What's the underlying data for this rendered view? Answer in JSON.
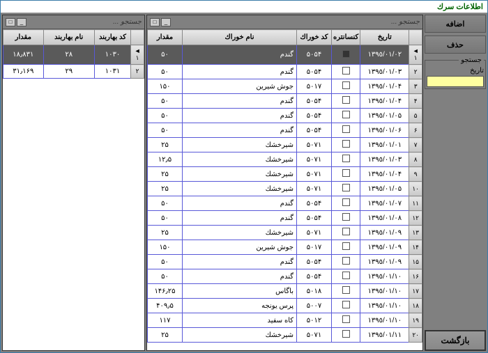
{
  "window": {
    "title": "اطلاعات سرك"
  },
  "sidebar": {
    "add": "اضافه",
    "delete": "حذف",
    "search_group": "جستجو",
    "date_label": "تاریخ",
    "back": "بازگشت"
  },
  "panel": {
    "search_hint": "جستجو ..."
  },
  "main_grid": {
    "headers": {
      "date": "تاریخ",
      "concentrate": "کنسانتره",
      "feed_code": "كد خوراك",
      "feed_name": "نام خوراك",
      "qty": "مقدار"
    },
    "rows": [
      {
        "n": "١",
        "date": "١٣٩٥/٠١/٠٢",
        "chk": "filled",
        "code": "۵٠۵۴",
        "name": "گندم",
        "qty": "۵٠",
        "sel": true
      },
      {
        "n": "٢",
        "date": "١٣٩٥/٠١/٠٣",
        "chk": "",
        "code": "۵٠۵۴",
        "name": "گندم",
        "qty": "۵٠"
      },
      {
        "n": "٣",
        "date": "١٣٩٥/٠١/٠۴",
        "chk": "",
        "code": "۵٠١٧",
        "name": "جوش شیرین",
        "qty": "١۵٠"
      },
      {
        "n": "۴",
        "date": "١٣٩٥/٠١/٠۴",
        "chk": "",
        "code": "۵٠۵۴",
        "name": "گندم",
        "qty": "۵٠"
      },
      {
        "n": "۵",
        "date": "١٣٩٥/٠١/٠۵",
        "chk": "",
        "code": "۵٠۵۴",
        "name": "گندم",
        "qty": "۵٠"
      },
      {
        "n": "۶",
        "date": "١٣٩٥/٠١/٠۶",
        "chk": "",
        "code": "۵٠۵۴",
        "name": "گندم",
        "qty": "۵٠"
      },
      {
        "n": "٧",
        "date": "١٣٩٥/٠١/٠١",
        "chk": "",
        "code": "۵٠٧١",
        "name": "شیرخشك",
        "qty": "٢۵"
      },
      {
        "n": "٨",
        "date": "١٣٩٥/٠١/٠٣",
        "chk": "",
        "code": "۵٠٧١",
        "name": "شيرخشك",
        "qty": "١٢٫۵"
      },
      {
        "n": "٩",
        "date": "١٣٩٥/٠١/٠۴",
        "chk": "",
        "code": "۵٠٧١",
        "name": "شيرخشك",
        "qty": "٢۵"
      },
      {
        "n": "١٠",
        "date": "١٣٩٥/٠١/٠۵",
        "chk": "",
        "code": "۵٠٧١",
        "name": "شيرخشك",
        "qty": "٢۵"
      },
      {
        "n": "١١",
        "date": "١٣٩٥/٠١/٠٧",
        "chk": "",
        "code": "۵٠۵۴",
        "name": "گندم",
        "qty": "۵٠"
      },
      {
        "n": "١٢",
        "date": "١٣٩٥/٠١/٠٨",
        "chk": "",
        "code": "۵٠۵۴",
        "name": "گندم",
        "qty": "۵٠"
      },
      {
        "n": "١٣",
        "date": "١٣٩٥/٠١/٠٩",
        "chk": "",
        "code": "۵٠٧١",
        "name": "شيرخشك",
        "qty": "٢۵"
      },
      {
        "n": "١۴",
        "date": "١٣٩٥/٠١/٠٩",
        "chk": "",
        "code": "۵٠١٧",
        "name": "جوش شیرین",
        "qty": "١۵٠"
      },
      {
        "n": "١۵",
        "date": "١٣٩٥/٠١/٠٩",
        "chk": "",
        "code": "۵٠۵۴",
        "name": "گندم",
        "qty": "۵٠"
      },
      {
        "n": "١۶",
        "date": "١٣٩٥/٠١/١٠",
        "chk": "",
        "code": "۵٠۵۴",
        "name": "گندم",
        "qty": "۵٠"
      },
      {
        "n": "١٧",
        "date": "١٣٩٥/٠١/١٠",
        "chk": "",
        "code": "۵٠١٨",
        "name": "باگاس",
        "qty": "١۴۶٫٢۵"
      },
      {
        "n": "١٨",
        "date": "١٣٩٥/٠١/١٠",
        "chk": "",
        "code": "۵٠٠٧",
        "name": "پرس یونجه",
        "qty": "۴٠٩٫۵"
      },
      {
        "n": "١٩",
        "date": "١٣٩٥/٠١/١٠",
        "chk": "",
        "code": "۵٠١٢",
        "name": "كاه سفید",
        "qty": "١١٧"
      },
      {
        "n": "٢٠",
        "date": "١٣٩٥/٠١/١١",
        "chk": "",
        "code": "۵٠٧١",
        "name": "شيرخشك",
        "qty": "٢۵"
      }
    ]
  },
  "side_grid": {
    "headers": {
      "code": "كد بهاربند",
      "name": "نام بهاربند",
      "qty": "مقدار"
    },
    "rows": [
      {
        "n": "١",
        "code": "١٠٣٠",
        "name": "٢٨",
        "qty": "١٨٫٨٣١",
        "sel": true
      },
      {
        "n": "٢",
        "code": "١٠٣١",
        "name": "٢٩",
        "qty": "٣١٫١۶٩"
      }
    ]
  }
}
